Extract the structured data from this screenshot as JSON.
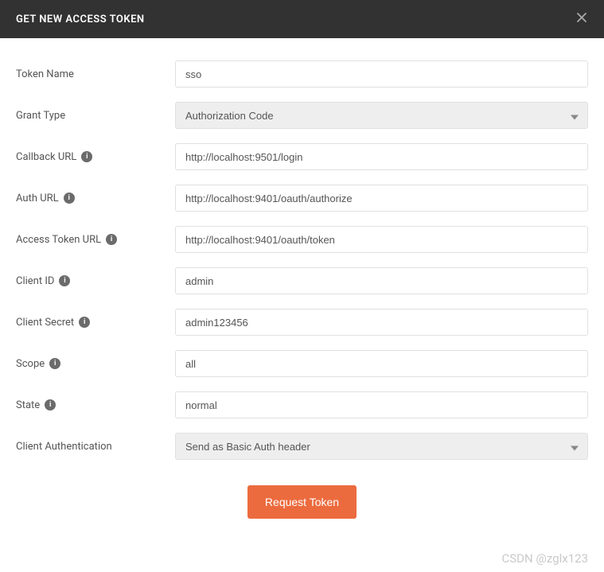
{
  "modal": {
    "title": "GET NEW ACCESS TOKEN"
  },
  "fields": {
    "tokenName": {
      "label": "Token Name",
      "value": "sso"
    },
    "grantType": {
      "label": "Grant Type",
      "value": "Authorization Code"
    },
    "callbackUrl": {
      "label": "Callback URL",
      "value": "http://localhost:9501/login"
    },
    "authUrl": {
      "label": "Auth URL",
      "value": "http://localhost:9401/oauth/authorize"
    },
    "accessTokenUrl": {
      "label": "Access Token URL",
      "value": "http://localhost:9401/oauth/token"
    },
    "clientId": {
      "label": "Client ID",
      "value": "admin"
    },
    "clientSecret": {
      "label": "Client Secret",
      "value": "admin123456"
    },
    "scope": {
      "label": "Scope",
      "value": "all"
    },
    "state": {
      "label": "State",
      "value": "normal"
    },
    "clientAuth": {
      "label": "Client Authentication",
      "value": "Send as Basic Auth header"
    }
  },
  "buttons": {
    "request": "Request Token"
  },
  "watermark": "CSDN @zglx123"
}
